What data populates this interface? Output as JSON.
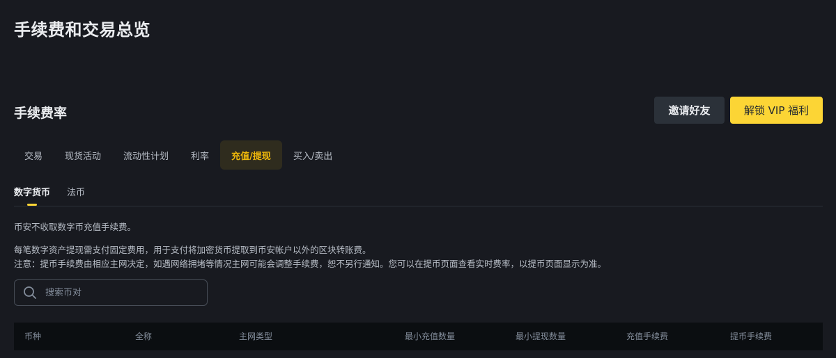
{
  "page": {
    "title": "手续费和交易总览"
  },
  "section": {
    "title": "手续费率"
  },
  "actions": {
    "invite_label": "邀请好友",
    "vip_label": "解锁 VIP 福利"
  },
  "tabs": [
    {
      "label": "交易",
      "active": false
    },
    {
      "label": "现货活动",
      "active": false
    },
    {
      "label": "流动性计划",
      "active": false
    },
    {
      "label": "利率",
      "active": false
    },
    {
      "label": "充值/提现",
      "active": true
    },
    {
      "label": "买入/卖出",
      "active": false
    }
  ],
  "subtabs": [
    {
      "label": "数字货币",
      "active": true
    },
    {
      "label": "法币",
      "active": false
    }
  ],
  "notes": {
    "deposit": "币安不收取数字币充值手续费。",
    "withdraw": "每笔数字资产提现需支付固定费用，用于支付将加密货币提取到币安帐户以外的区块转账费。",
    "notice": "注意：提币手续费由相应主网决定，如遇网络拥堵等情况主网可能会调整手续费，恕不另行通知。您可以在提币页面查看实时费率，以提币页面显示为准。"
  },
  "search": {
    "placeholder": "搜索币对",
    "value": ""
  },
  "table": {
    "columns": [
      "币种",
      "全称",
      "主网类型",
      "最小充值数量",
      "最小提现数量",
      "充值手续费",
      "提币手续费"
    ]
  },
  "colors": {
    "background": "#181a20",
    "accent": "#fcd535",
    "active_tab_text": "#f0b90b",
    "active_tab_bg": "#2f2c1e",
    "secondary_button": "#2b3139",
    "table_header_bg": "#0b0e11"
  },
  "icons": {
    "search": "search-icon"
  }
}
